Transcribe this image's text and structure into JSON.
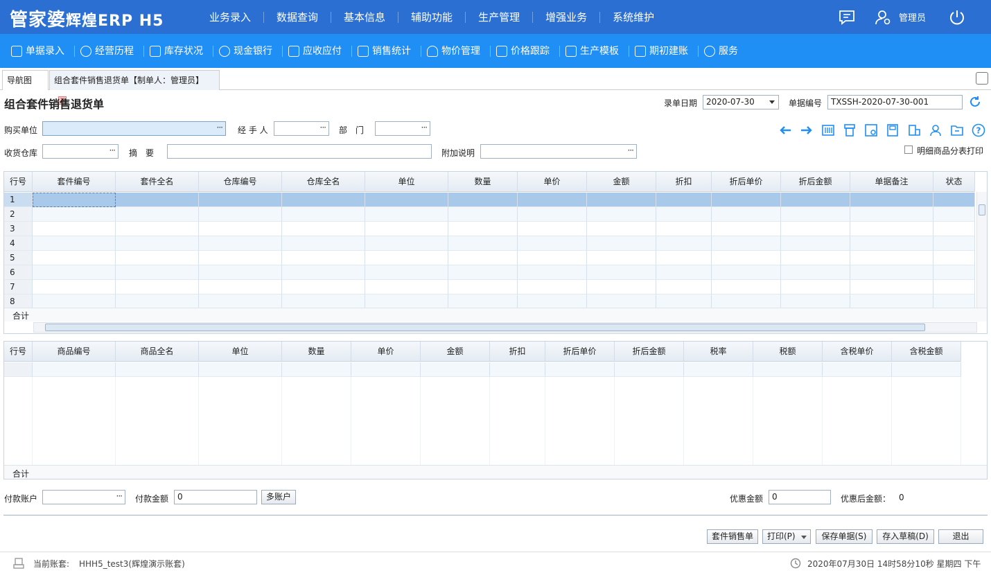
{
  "app": {
    "logo_main": "管家婆",
    "logo_sub": "辉煌ERP H5",
    "user": "管理员"
  },
  "main_menu": [
    "业务录入",
    "数据查询",
    "基本信息",
    "辅助功能",
    "生产管理",
    "增强业务",
    "系统维护"
  ],
  "toolbar": [
    {
      "label": "单据录入",
      "icon": "edit-icon"
    },
    {
      "label": "经营历程",
      "icon": "history-icon"
    },
    {
      "label": "库存状况",
      "icon": "inventory-icon"
    },
    {
      "label": "现金银行",
      "icon": "yuan-icon"
    },
    {
      "label": "应收应付",
      "icon": "receivable-icon"
    },
    {
      "label": "销售统计",
      "icon": "chart-icon"
    },
    {
      "label": "物价管理",
      "icon": "price-icon"
    },
    {
      "label": "价格跟踪",
      "icon": "tracking-icon"
    },
    {
      "label": "生产模板",
      "icon": "template-icon"
    },
    {
      "label": "期初建账",
      "icon": "ledger-icon"
    },
    {
      "label": "服务",
      "icon": "help-icon"
    }
  ],
  "tabs": {
    "nav": "导航图",
    "active": "组合套件销售退货单【制单人：管理员】"
  },
  "form": {
    "title": "组合套件销售退货单",
    "date_label": "录单日期",
    "date_value": "2020-07-30",
    "number_label": "单据编号",
    "number_value": "TXSSH-2020-07-30-001",
    "buyer_label": "购买单位",
    "handler_label": "经 手 人",
    "dept_label": "部　门",
    "warehouse_label": "收货仓库",
    "summary_label": "摘　要",
    "note_label": "附加说明",
    "detail_print_label": "明细商品分表打印"
  },
  "grid1": {
    "columns": [
      "行号",
      "套件编号",
      "套件全名",
      "仓库编号",
      "仓库全名",
      "单位",
      "数量",
      "单价",
      "金额",
      "折扣",
      "折后单价",
      "折后金额",
      "单据备注",
      "状态"
    ],
    "rows": [
      "1",
      "2",
      "3",
      "4",
      "5",
      "6",
      "7",
      "8"
    ],
    "total_label": "合计"
  },
  "grid2": {
    "columns": [
      "行号",
      "商品编号",
      "商品全名",
      "单位",
      "数量",
      "单价",
      "金额",
      "折扣",
      "折后单价",
      "折后金额",
      "税率",
      "税额",
      "含税单价",
      "含税金额"
    ],
    "total_label": "合计"
  },
  "payment": {
    "account_label": "付款账户",
    "amount_label": "付款金额",
    "amount_value": "0",
    "multi_button": "多账户",
    "discount_label": "优惠金额",
    "discount_value": "0",
    "after_label": "优惠后金额：",
    "after_value": "0"
  },
  "buttons": {
    "kit_sales": "套件销售单",
    "print": "打印(P)",
    "save": "保存单据(S)",
    "draft": "存入草稿(D)",
    "exit": "退出"
  },
  "status": {
    "account_label": "当前账套:",
    "account_value": "HHH5_test3(辉煌演示账套)",
    "datetime": "2020年07月30日 14时58分10秒 星期四 下午"
  },
  "colors": {
    "topbar": "#2c6fd3",
    "toolbar": "#1f8ef5",
    "selected_row": "#a9c9ea"
  }
}
